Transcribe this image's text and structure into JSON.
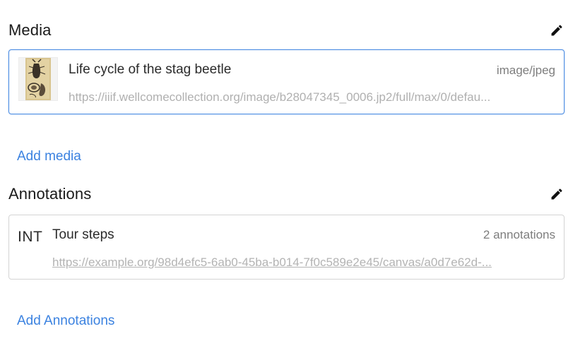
{
  "media": {
    "title": "Media",
    "edit_icon": "pencil-icon",
    "item": {
      "title": "Life cycle of the stag beetle",
      "mime_type": "image/jpeg",
      "url": "https://iiif.wellcomecollection.org/image/b28047345_0006.jp2/full/max/0/defau..."
    },
    "add_label": "Add media"
  },
  "annotations": {
    "title": "Annotations",
    "edit_icon": "pencil-icon",
    "item": {
      "type_label": "INT",
      "title": "Tour steps",
      "count": "2 annotations",
      "url": "https://example.org/98d4efc5-6ab0-45ba-b014-7f0c589e2e45/canvas/a0d7e62d-..."
    },
    "add_label": "Add Annotations"
  },
  "colors": {
    "accent": "#3b82e0",
    "selected_border": "#4a8be2"
  }
}
